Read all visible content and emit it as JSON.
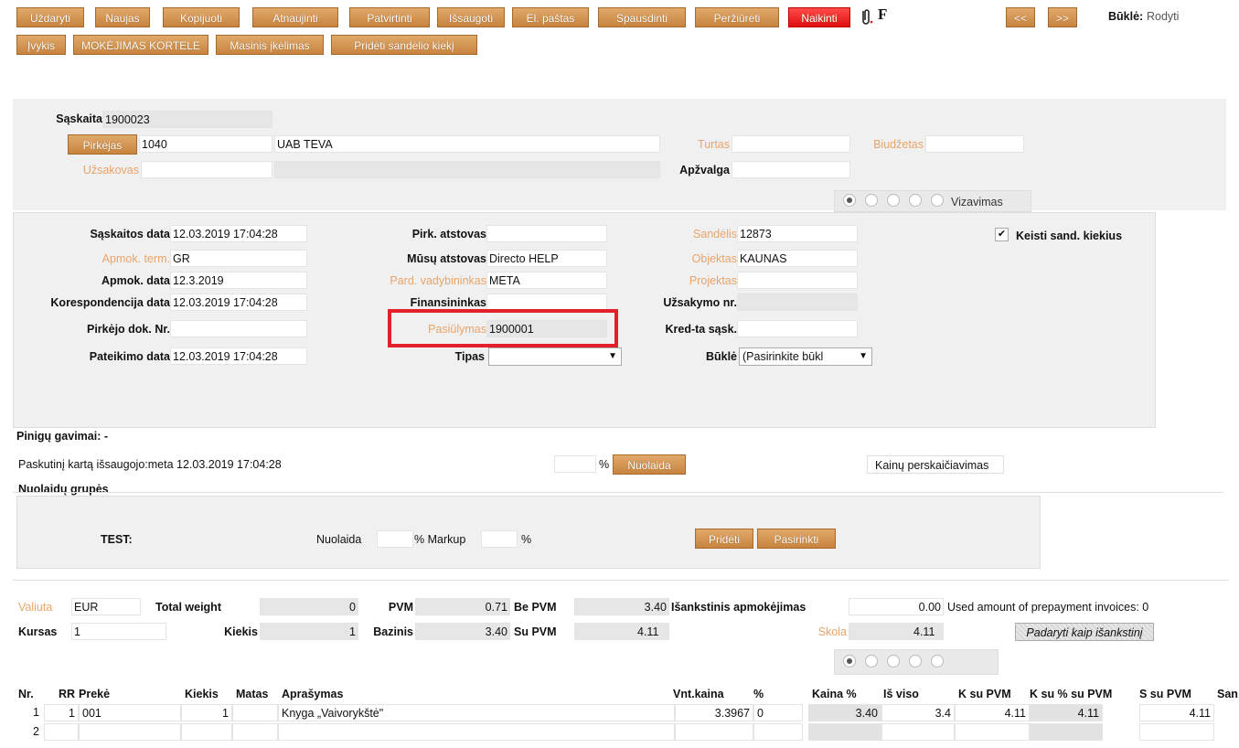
{
  "toolbar": {
    "row1": [
      "Uždaryti",
      "Naujas",
      "Kopijuoti",
      "Atnaujinti",
      "Patvirtinti",
      "Išsaugoti",
      "El. paštas",
      "Spausdinti",
      "Peržiūrėti",
      "Naikinti"
    ],
    "row2": [
      "Įvykis",
      "MOKĖJIMAS KORTELE",
      "Masinis įkėlimas",
      "Pridėti sandėlio kiekį"
    ],
    "attach_icon": "paperclip-icon",
    "font_icon": "F",
    "prev": "<<",
    "next": ">>",
    "status_label": "Būklė:",
    "status_value": "Rodyti"
  },
  "header": {
    "saskaita_label": "Sąskaita",
    "saskaita_value": "1900023",
    "pirkejas_button": "Pirkėjas",
    "pirkejas_code": "1040",
    "pirkejas_name": "UAB TEVA",
    "turtas_label": "Turtas",
    "biudzetas_label": "Biudžetas",
    "uzsakovas_label": "Užsakovas",
    "apzvalga_label": "Apžvalga",
    "vizavimas_label": "Vizavimas"
  },
  "details": {
    "col1": [
      {
        "label": "Sąskaitos data",
        "value": "12.03.2019 17:04:28",
        "style": "bold"
      },
      {
        "label": "Apmok. term.",
        "value": "GR",
        "style": "orange"
      },
      {
        "label": "Apmok. data",
        "value": "12.3.2019",
        "style": "bold"
      },
      {
        "label": "Korespondencija data",
        "value": "12.03.2019 17:04:28",
        "style": "bold"
      },
      {
        "label": "Pirkėjo dok. Nr.",
        "value": "",
        "style": "bold"
      },
      {
        "label": "Pateikimo data",
        "value": "12.03.2019 17:04:28",
        "style": "bold"
      }
    ],
    "col2": [
      {
        "label": "Pirk. atstovas",
        "value": "",
        "style": "bold"
      },
      {
        "label": "Mūsų atstovas",
        "value": "Directo HELP",
        "style": "bold"
      },
      {
        "label": "Pard. vadybininkas",
        "value": "META",
        "style": "orange"
      },
      {
        "label": "Finansininkas",
        "value": "",
        "style": "bold"
      },
      {
        "label": "Pasiūlymas",
        "value": "1900001",
        "style": "orange"
      },
      {
        "label": "Tipas",
        "value": "",
        "style": "bold"
      }
    ],
    "col3": [
      {
        "label": "Sandėlis",
        "value": "12873",
        "style": "orange"
      },
      {
        "label": "Objektas",
        "value": "KAUNAS",
        "style": "orange"
      },
      {
        "label": "Projektas",
        "value": "",
        "style": "orange"
      },
      {
        "label": "Užsakymo nr.",
        "value": "",
        "style": "bold"
      },
      {
        "label": "Kred-ta sąsk.",
        "value": "",
        "style": "bold"
      },
      {
        "label": "Būklė",
        "value": "(Pasirinkite būkl",
        "style": "bold"
      }
    ],
    "keisti_label": "Keisti sand. kiekius"
  },
  "payments": {
    "pinigu_label": "Pinigų gavimai: -",
    "last_saved": "Paskutinį kartą išsaugojo:meta 12.03.2019 17:04:28",
    "percent_sign": "%",
    "nuolaida_button": "Nuolaida",
    "kainu_button": "Kainų perskaičiavimas"
  },
  "discount_groups": {
    "title": "Nuolaidų grupės",
    "name": "TEST:",
    "nuolaida_label": "Nuolaida",
    "markup_label": "% Markup",
    "percent": "%",
    "prideti_button": "Pridėti",
    "pasirinkti_button": "Pasirinkti"
  },
  "totals": {
    "valiuta_label": "Valiuta",
    "valiuta_value": "EUR",
    "kursas_label": "Kursas",
    "kursas_value": "1",
    "total_weight_label": "Total weight",
    "total_weight_value": "0",
    "kiekis_label": "Kiekis",
    "kiekis_value": "1",
    "pvm_label": "PVM",
    "pvm_value": "0.71",
    "bazinis_label": "Bazinis",
    "bazinis_value": "3.40",
    "be_pvm_label": "Be PVM",
    "be_pvm_value": "3.40",
    "su_pvm_label": "Su PVM",
    "su_pvm_value": "4.11",
    "isankstinis_label": "Išankstinis apmokėjimas",
    "isankstinis_value": "0.00",
    "used_label": "Used amount of prepayment invoices: 0",
    "skola_label": "Skola",
    "skola_value": "4.11",
    "padaryti_button": "Padaryti kaip išankstinį"
  },
  "table": {
    "headers": [
      "Nr.",
      "RR",
      "Prekė",
      "Kiekis",
      "Matas",
      "Aprašymas",
      "Vnt.kaina",
      "%",
      "Kaina %",
      "Iš viso",
      "K su PVM",
      "K su % su PVM",
      "S su PVM",
      "San"
    ],
    "rows": [
      {
        "nr": "1",
        "rr": "1",
        "preke": "001",
        "kiekis": "1",
        "matas": "",
        "aprasymas": "Knyga „Vaivorykštė\"",
        "vnt": "3.3967",
        "pct": "0",
        "kaina_pct": "3.40",
        "is_viso": "3.4",
        "k_su_pvm": "4.11",
        "k_su_pct": "4.11",
        "s_su_pvm": "4.11"
      },
      {
        "nr": "2",
        "rr": "",
        "preke": "",
        "kiekis": "",
        "matas": "",
        "aprasymas": "",
        "vnt": "",
        "pct": "",
        "kaina_pct": "",
        "is_viso": "",
        "k_su_pvm": "",
        "k_su_pct": "",
        "s_su_pvm": ""
      }
    ]
  }
}
